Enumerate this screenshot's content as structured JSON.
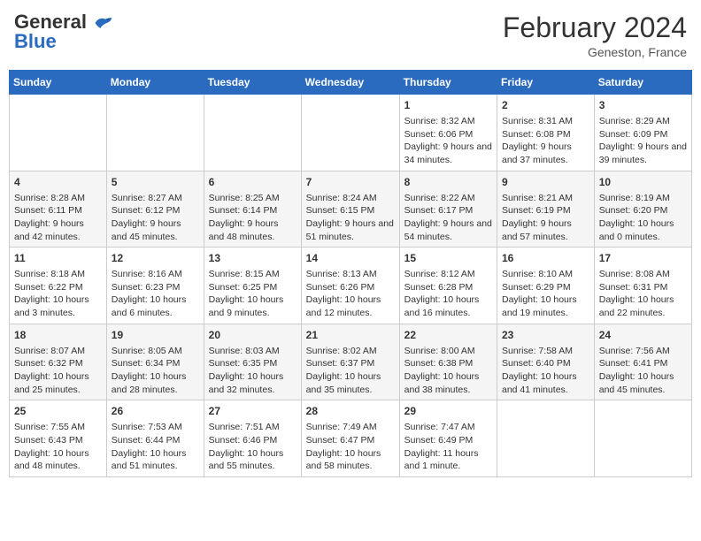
{
  "header": {
    "logo_general": "General",
    "logo_blue": "Blue",
    "title": "February 2024",
    "subtitle": "Geneston, France"
  },
  "weekdays": [
    "Sunday",
    "Monday",
    "Tuesday",
    "Wednesday",
    "Thursday",
    "Friday",
    "Saturday"
  ],
  "weeks": [
    [
      {
        "day": "",
        "info": ""
      },
      {
        "day": "",
        "info": ""
      },
      {
        "day": "",
        "info": ""
      },
      {
        "day": "",
        "info": ""
      },
      {
        "day": "1",
        "info": "Sunrise: 8:32 AM\nSunset: 6:06 PM\nDaylight: 9 hours and 34 minutes."
      },
      {
        "day": "2",
        "info": "Sunrise: 8:31 AM\nSunset: 6:08 PM\nDaylight: 9 hours and 37 minutes."
      },
      {
        "day": "3",
        "info": "Sunrise: 8:29 AM\nSunset: 6:09 PM\nDaylight: 9 hours and 39 minutes."
      }
    ],
    [
      {
        "day": "4",
        "info": "Sunrise: 8:28 AM\nSunset: 6:11 PM\nDaylight: 9 hours and 42 minutes."
      },
      {
        "day": "5",
        "info": "Sunrise: 8:27 AM\nSunset: 6:12 PM\nDaylight: 9 hours and 45 minutes."
      },
      {
        "day": "6",
        "info": "Sunrise: 8:25 AM\nSunset: 6:14 PM\nDaylight: 9 hours and 48 minutes."
      },
      {
        "day": "7",
        "info": "Sunrise: 8:24 AM\nSunset: 6:15 PM\nDaylight: 9 hours and 51 minutes."
      },
      {
        "day": "8",
        "info": "Sunrise: 8:22 AM\nSunset: 6:17 PM\nDaylight: 9 hours and 54 minutes."
      },
      {
        "day": "9",
        "info": "Sunrise: 8:21 AM\nSunset: 6:19 PM\nDaylight: 9 hours and 57 minutes."
      },
      {
        "day": "10",
        "info": "Sunrise: 8:19 AM\nSunset: 6:20 PM\nDaylight: 10 hours and 0 minutes."
      }
    ],
    [
      {
        "day": "11",
        "info": "Sunrise: 8:18 AM\nSunset: 6:22 PM\nDaylight: 10 hours and 3 minutes."
      },
      {
        "day": "12",
        "info": "Sunrise: 8:16 AM\nSunset: 6:23 PM\nDaylight: 10 hours and 6 minutes."
      },
      {
        "day": "13",
        "info": "Sunrise: 8:15 AM\nSunset: 6:25 PM\nDaylight: 10 hours and 9 minutes."
      },
      {
        "day": "14",
        "info": "Sunrise: 8:13 AM\nSunset: 6:26 PM\nDaylight: 10 hours and 12 minutes."
      },
      {
        "day": "15",
        "info": "Sunrise: 8:12 AM\nSunset: 6:28 PM\nDaylight: 10 hours and 16 minutes."
      },
      {
        "day": "16",
        "info": "Sunrise: 8:10 AM\nSunset: 6:29 PM\nDaylight: 10 hours and 19 minutes."
      },
      {
        "day": "17",
        "info": "Sunrise: 8:08 AM\nSunset: 6:31 PM\nDaylight: 10 hours and 22 minutes."
      }
    ],
    [
      {
        "day": "18",
        "info": "Sunrise: 8:07 AM\nSunset: 6:32 PM\nDaylight: 10 hours and 25 minutes."
      },
      {
        "day": "19",
        "info": "Sunrise: 8:05 AM\nSunset: 6:34 PM\nDaylight: 10 hours and 28 minutes."
      },
      {
        "day": "20",
        "info": "Sunrise: 8:03 AM\nSunset: 6:35 PM\nDaylight: 10 hours and 32 minutes."
      },
      {
        "day": "21",
        "info": "Sunrise: 8:02 AM\nSunset: 6:37 PM\nDaylight: 10 hours and 35 minutes."
      },
      {
        "day": "22",
        "info": "Sunrise: 8:00 AM\nSunset: 6:38 PM\nDaylight: 10 hours and 38 minutes."
      },
      {
        "day": "23",
        "info": "Sunrise: 7:58 AM\nSunset: 6:40 PM\nDaylight: 10 hours and 41 minutes."
      },
      {
        "day": "24",
        "info": "Sunrise: 7:56 AM\nSunset: 6:41 PM\nDaylight: 10 hours and 45 minutes."
      }
    ],
    [
      {
        "day": "25",
        "info": "Sunrise: 7:55 AM\nSunset: 6:43 PM\nDaylight: 10 hours and 48 minutes."
      },
      {
        "day": "26",
        "info": "Sunrise: 7:53 AM\nSunset: 6:44 PM\nDaylight: 10 hours and 51 minutes."
      },
      {
        "day": "27",
        "info": "Sunrise: 7:51 AM\nSunset: 6:46 PM\nDaylight: 10 hours and 55 minutes."
      },
      {
        "day": "28",
        "info": "Sunrise: 7:49 AM\nSunset: 6:47 PM\nDaylight: 10 hours and 58 minutes."
      },
      {
        "day": "29",
        "info": "Sunrise: 7:47 AM\nSunset: 6:49 PM\nDaylight: 11 hours and 1 minute."
      },
      {
        "day": "",
        "info": ""
      },
      {
        "day": "",
        "info": ""
      }
    ]
  ]
}
